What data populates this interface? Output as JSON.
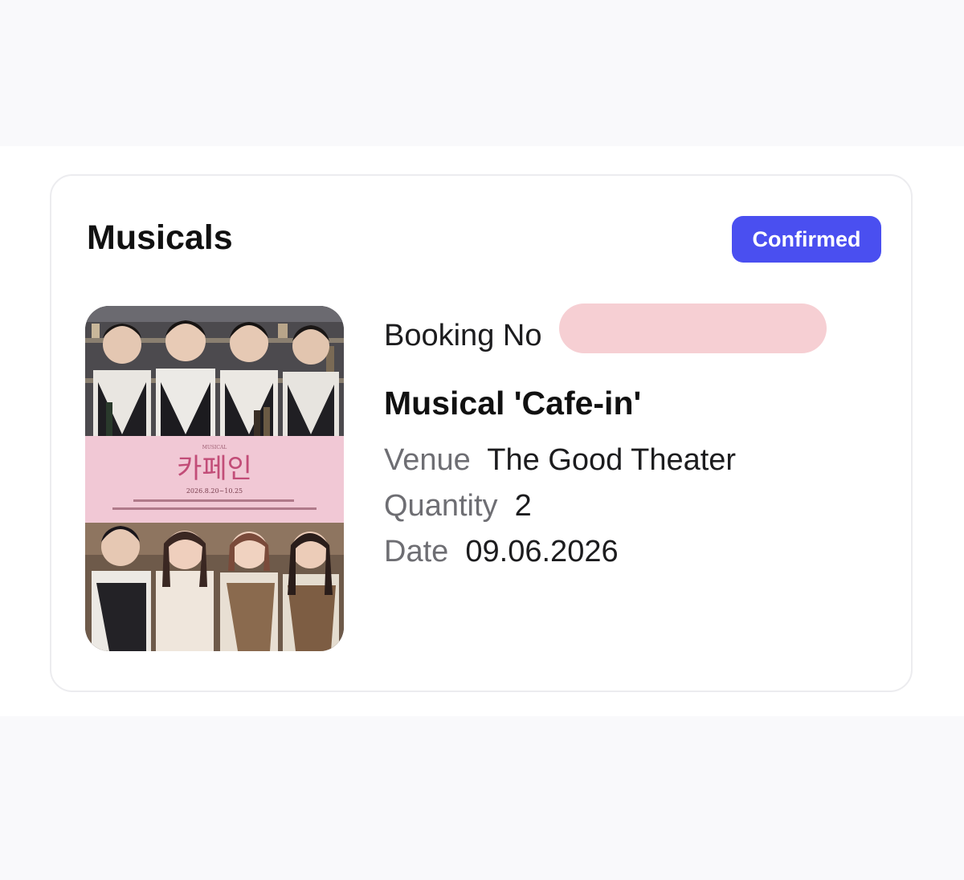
{
  "card": {
    "category": "Musicals",
    "status": "Confirmed",
    "colors": {
      "status_bg": "#4a4ff0",
      "redaction": "#f6cfd3"
    }
  },
  "poster": {
    "label_small": "MUSICAL",
    "title_ko": "카페인",
    "dates": "2026.8.20~10.25"
  },
  "booking": {
    "label": "Booking No"
  },
  "event": {
    "title": "Musical 'Cafe-in'"
  },
  "details": {
    "venue_label": "Venue",
    "venue_value": "The Good Theater",
    "quantity_label": "Quantity",
    "quantity_value": "2",
    "date_label": "Date",
    "date_value": "09.06.2026"
  }
}
